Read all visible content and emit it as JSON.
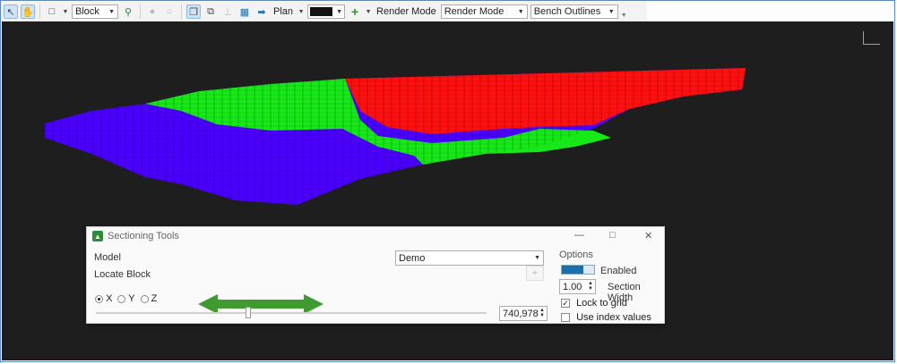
{
  "toolbar": {
    "select_value": "Block",
    "plan_label": "Plan",
    "color_value": "#111111",
    "render_mode_label": "Render Mode",
    "render_mode_value": "Render Mode",
    "outline_value": "Bench Outlines"
  },
  "colors": {
    "viewport_bg": "#1e1e1e",
    "block_blue": "#4b00ff",
    "block_green": "#17e817",
    "block_red": "#ff1010",
    "accent": "#1a6fb0",
    "arrow_green": "#3f9b2f"
  },
  "panel": {
    "title": "Sectioning Tools",
    "model_label": "Model",
    "model_value": "Demo",
    "locate_label": "Locate Block",
    "axis_options": [
      "X",
      "Y",
      "Z"
    ],
    "axis_selected": "X",
    "slider_value": "740,978",
    "slider_position": 0.39,
    "options_heading": "Options",
    "enabled_label": "Enabled",
    "width_value": "1.00",
    "width_label": "Section Width",
    "lock_label": "Lock to grid",
    "lock_checked": true,
    "index_label": "Use index values",
    "index_checked": false
  }
}
